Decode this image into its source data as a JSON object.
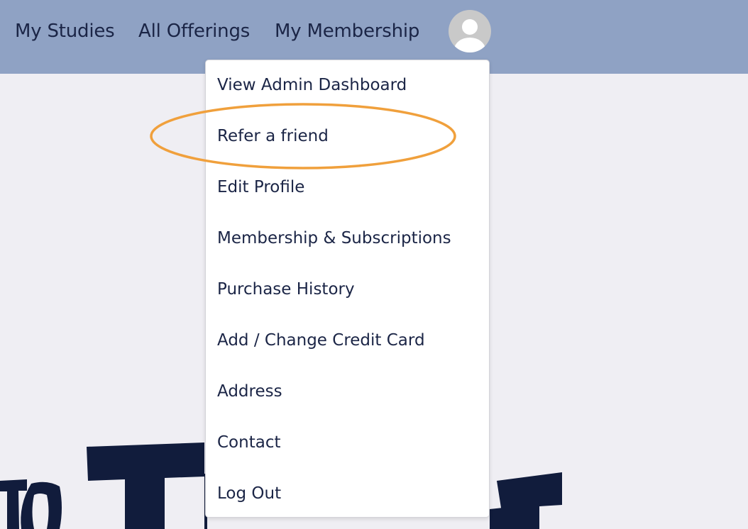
{
  "nav": {
    "links": [
      {
        "label": "My Studies"
      },
      {
        "label": "All Offerings"
      },
      {
        "label": "My Membership"
      }
    ],
    "avatar_icon": "user-avatar-icon"
  },
  "dropdown": {
    "items": [
      {
        "label": "View Admin Dashboard"
      },
      {
        "label": "Refer a friend",
        "highlighted": true
      },
      {
        "label": "Edit Profile"
      },
      {
        "label": "Membership & Subscriptions"
      },
      {
        "label": "Purchase History"
      },
      {
        "label": "Add / Change Credit Card"
      },
      {
        "label": "Address"
      },
      {
        "label": "Contact"
      },
      {
        "label": "Log Out"
      }
    ]
  },
  "colors": {
    "topbar": "#8fa2c4",
    "page_background": "#efeef3",
    "text": "#1b2546",
    "highlight_ellipse": "#f0a03c",
    "background_art": "#111c3c"
  }
}
